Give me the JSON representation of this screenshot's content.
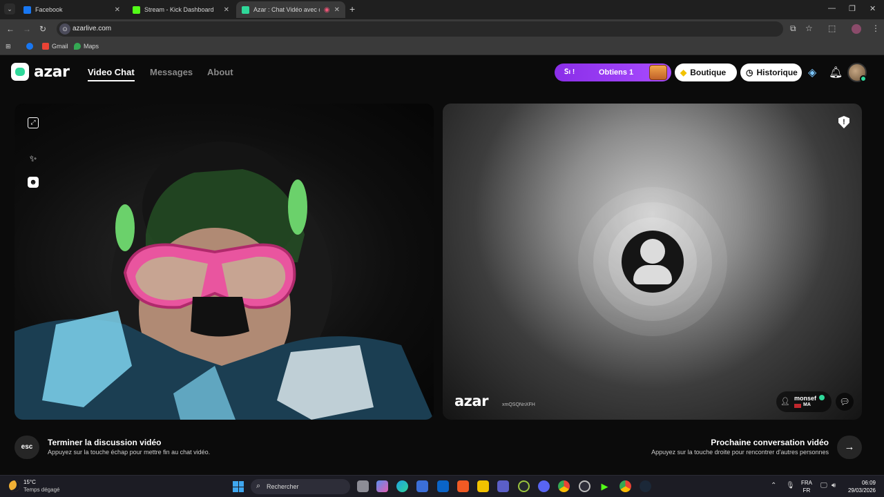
{
  "browser": {
    "tabs": [
      {
        "title": "Facebook",
        "color": "#1877f2"
      },
      {
        "title": "Stream - Kick Dashboard",
        "color": "#53fc18"
      },
      {
        "title": "Azar : Chat Vidéo avec de n",
        "color": "#2fd89a"
      }
    ],
    "url": "azarlive.com",
    "bookmarks": [
      {
        "label": "",
        "color": "#1877f2"
      },
      {
        "label": "Gmail",
        "color": "#ea4335"
      },
      {
        "label": "Maps",
        "color": "#34a853"
      }
    ]
  },
  "header": {
    "logo_text": "azar",
    "nav": [
      {
        "label": "Video Chat",
        "active": true
      },
      {
        "label": "Messages",
        "active": false
      },
      {
        "label": "About",
        "active": false
      }
    ],
    "promo": {
      "left_text": "ꓢı !",
      "right_text": "Obtiens 1"
    },
    "shop_label": "Boutique",
    "history_label": "Historique"
  },
  "partner_panel": {
    "watermark": "azar",
    "watermark_id": "xmQSQNnXFH",
    "partner_name": "monsef",
    "partner_country": "MA"
  },
  "controls": {
    "esc_key": "esc",
    "end_title": "Terminer la discussion vidéo",
    "end_subtitle": "Appuyez sur la touche échap pour mettre fin au chat vidéo.",
    "next_title": "Prochaine conversation vidéo",
    "next_subtitle": "Appuyez sur la touche droite pour rencontrer d'autres personnes",
    "next_arrow": "→"
  },
  "taskbar": {
    "temperature": "15°C",
    "weather": "Temps dégagé",
    "search_placeholder": "Rechercher",
    "lang_top": "FRA",
    "lang_bottom": "FR",
    "time": "06:09",
    "date": "29/03/2026"
  },
  "colors": {
    "accent": "#2fd89a",
    "promo": "#9b3ff6"
  }
}
